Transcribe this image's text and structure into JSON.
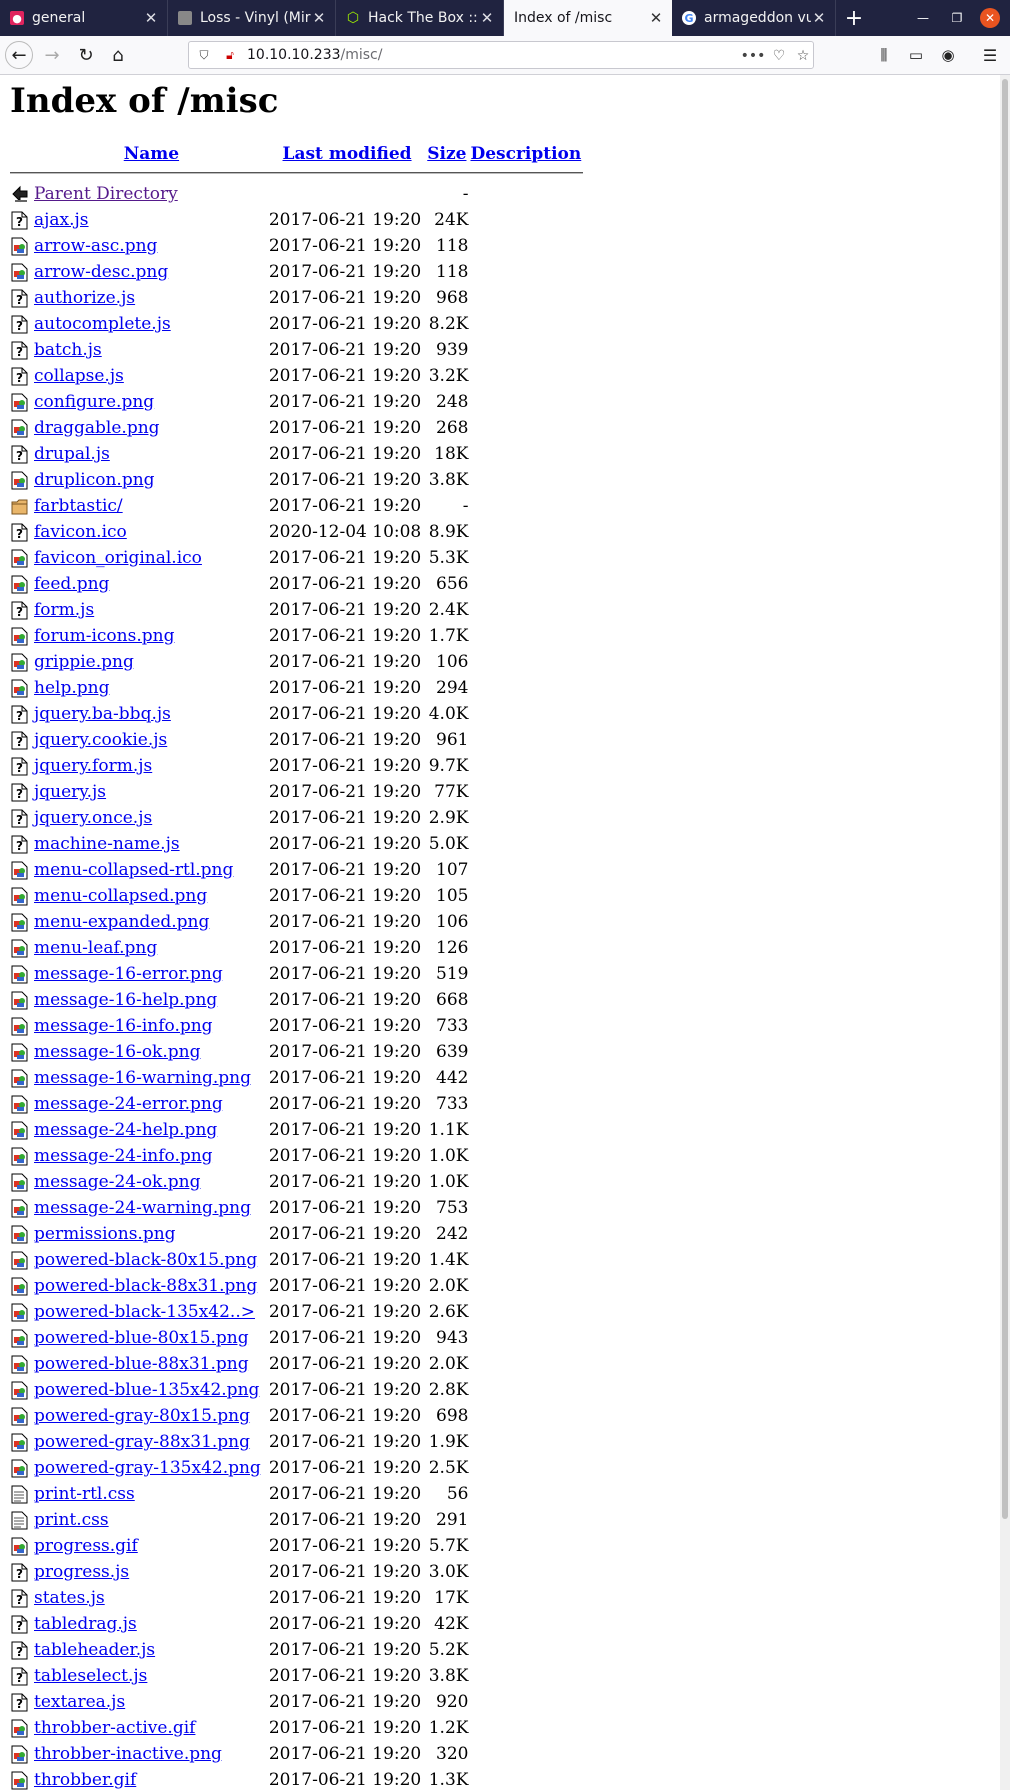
{
  "tabs": [
    {
      "title": "general",
      "favicon": "chat-app-icon",
      "color": "#e0245e"
    },
    {
      "title": "Loss - Vinyl (Mir",
      "favicon": "album-art-icon",
      "color": "#888888"
    },
    {
      "title": "Hack The Box :: I",
      "favicon": "htb-cube-icon",
      "color": "#9fef00"
    },
    {
      "title": "Index of /misc",
      "favicon": "",
      "color": ""
    },
    {
      "title": "armageddon vul",
      "favicon": "google-g-icon",
      "color": "#4285f4"
    }
  ],
  "address": {
    "host": "10.10.10.233",
    "path": "/misc/"
  },
  "page": {
    "title": "Index of /misc",
    "headers": {
      "name": "Name",
      "modified": "Last modified",
      "size": "Size",
      "description": "Description"
    }
  },
  "entries": [
    {
      "icon": "back",
      "name": "Parent Directory",
      "date": "",
      "size": "-"
    },
    {
      "icon": "unknown",
      "name": "ajax.js",
      "date": "2017-06-21 19:20",
      "size": "24K"
    },
    {
      "icon": "image",
      "name": "arrow-asc.png",
      "date": "2017-06-21 19:20",
      "size": "118"
    },
    {
      "icon": "image",
      "name": "arrow-desc.png",
      "date": "2017-06-21 19:20",
      "size": "118"
    },
    {
      "icon": "unknown",
      "name": "authorize.js",
      "date": "2017-06-21 19:20",
      "size": "968"
    },
    {
      "icon": "unknown",
      "name": "autocomplete.js",
      "date": "2017-06-21 19:20",
      "size": "8.2K"
    },
    {
      "icon": "unknown",
      "name": "batch.js",
      "date": "2017-06-21 19:20",
      "size": "939"
    },
    {
      "icon": "unknown",
      "name": "collapse.js",
      "date": "2017-06-21 19:20",
      "size": "3.2K"
    },
    {
      "icon": "image",
      "name": "configure.png",
      "date": "2017-06-21 19:20",
      "size": "248"
    },
    {
      "icon": "image",
      "name": "draggable.png",
      "date": "2017-06-21 19:20",
      "size": "268"
    },
    {
      "icon": "unknown",
      "name": "drupal.js",
      "date": "2017-06-21 19:20",
      "size": "18K"
    },
    {
      "icon": "image",
      "name": "druplicon.png",
      "date": "2017-06-21 19:20",
      "size": "3.8K"
    },
    {
      "icon": "folder",
      "name": "farbtastic/",
      "date": "2017-06-21 19:20",
      "size": "-"
    },
    {
      "icon": "unknown",
      "name": "favicon.ico",
      "date": "2020-12-04 10:08",
      "size": "8.9K"
    },
    {
      "icon": "image",
      "name": "favicon_original.ico",
      "date": "2017-06-21 19:20",
      "size": "5.3K"
    },
    {
      "icon": "image",
      "name": "feed.png",
      "date": "2017-06-21 19:20",
      "size": "656"
    },
    {
      "icon": "unknown",
      "name": "form.js",
      "date": "2017-06-21 19:20",
      "size": "2.4K"
    },
    {
      "icon": "image",
      "name": "forum-icons.png",
      "date": "2017-06-21 19:20",
      "size": "1.7K"
    },
    {
      "icon": "image",
      "name": "grippie.png",
      "date": "2017-06-21 19:20",
      "size": "106"
    },
    {
      "icon": "image",
      "name": "help.png",
      "date": "2017-06-21 19:20",
      "size": "294"
    },
    {
      "icon": "unknown",
      "name": "jquery.ba-bbq.js",
      "date": "2017-06-21 19:20",
      "size": "4.0K"
    },
    {
      "icon": "unknown",
      "name": "jquery.cookie.js",
      "date": "2017-06-21 19:20",
      "size": "961"
    },
    {
      "icon": "unknown",
      "name": "jquery.form.js",
      "date": "2017-06-21 19:20",
      "size": "9.7K"
    },
    {
      "icon": "unknown",
      "name": "jquery.js",
      "date": "2017-06-21 19:20",
      "size": "77K"
    },
    {
      "icon": "unknown",
      "name": "jquery.once.js",
      "date": "2017-06-21 19:20",
      "size": "2.9K"
    },
    {
      "icon": "unknown",
      "name": "machine-name.js",
      "date": "2017-06-21 19:20",
      "size": "5.0K"
    },
    {
      "icon": "image",
      "name": "menu-collapsed-rtl.png",
      "date": "2017-06-21 19:20",
      "size": "107"
    },
    {
      "icon": "image",
      "name": "menu-collapsed.png",
      "date": "2017-06-21 19:20",
      "size": "105"
    },
    {
      "icon": "image",
      "name": "menu-expanded.png",
      "date": "2017-06-21 19:20",
      "size": "106"
    },
    {
      "icon": "image",
      "name": "menu-leaf.png",
      "date": "2017-06-21 19:20",
      "size": "126"
    },
    {
      "icon": "image",
      "name": "message-16-error.png",
      "date": "2017-06-21 19:20",
      "size": "519"
    },
    {
      "icon": "image",
      "name": "message-16-help.png",
      "date": "2017-06-21 19:20",
      "size": "668"
    },
    {
      "icon": "image",
      "name": "message-16-info.png",
      "date": "2017-06-21 19:20",
      "size": "733"
    },
    {
      "icon": "image",
      "name": "message-16-ok.png",
      "date": "2017-06-21 19:20",
      "size": "639"
    },
    {
      "icon": "image",
      "name": "message-16-warning.png",
      "date": "2017-06-21 19:20",
      "size": "442"
    },
    {
      "icon": "image",
      "name": "message-24-error.png",
      "date": "2017-06-21 19:20",
      "size": "733"
    },
    {
      "icon": "image",
      "name": "message-24-help.png",
      "date": "2017-06-21 19:20",
      "size": "1.1K"
    },
    {
      "icon": "image",
      "name": "message-24-info.png",
      "date": "2017-06-21 19:20",
      "size": "1.0K"
    },
    {
      "icon": "image",
      "name": "message-24-ok.png",
      "date": "2017-06-21 19:20",
      "size": "1.0K"
    },
    {
      "icon": "image",
      "name": "message-24-warning.png",
      "date": "2017-06-21 19:20",
      "size": "753"
    },
    {
      "icon": "image",
      "name": "permissions.png",
      "date": "2017-06-21 19:20",
      "size": "242"
    },
    {
      "icon": "image",
      "name": "powered-black-80x15.png",
      "date": "2017-06-21 19:20",
      "size": "1.4K"
    },
    {
      "icon": "image",
      "name": "powered-black-88x31.png",
      "date": "2017-06-21 19:20",
      "size": "2.0K"
    },
    {
      "icon": "image",
      "name": "powered-black-135x42..>",
      "date": "2017-06-21 19:20",
      "size": "2.6K"
    },
    {
      "icon": "image",
      "name": "powered-blue-80x15.png",
      "date": "2017-06-21 19:20",
      "size": "943"
    },
    {
      "icon": "image",
      "name": "powered-blue-88x31.png",
      "date": "2017-06-21 19:20",
      "size": "2.0K"
    },
    {
      "icon": "image",
      "name": "powered-blue-135x42.png",
      "date": "2017-06-21 19:20",
      "size": "2.8K"
    },
    {
      "icon": "image",
      "name": "powered-gray-80x15.png",
      "date": "2017-06-21 19:20",
      "size": "698"
    },
    {
      "icon": "image",
      "name": "powered-gray-88x31.png",
      "date": "2017-06-21 19:20",
      "size": "1.9K"
    },
    {
      "icon": "image",
      "name": "powered-gray-135x42.png",
      "date": "2017-06-21 19:20",
      "size": "2.5K"
    },
    {
      "icon": "text",
      "name": "print-rtl.css",
      "date": "2017-06-21 19:20",
      "size": "56"
    },
    {
      "icon": "text",
      "name": "print.css",
      "date": "2017-06-21 19:20",
      "size": "291"
    },
    {
      "icon": "image",
      "name": "progress.gif",
      "date": "2017-06-21 19:20",
      "size": "5.7K"
    },
    {
      "icon": "unknown",
      "name": "progress.js",
      "date": "2017-06-21 19:20",
      "size": "3.0K"
    },
    {
      "icon": "unknown",
      "name": "states.js",
      "date": "2017-06-21 19:20",
      "size": "17K"
    },
    {
      "icon": "unknown",
      "name": "tabledrag.js",
      "date": "2017-06-21 19:20",
      "size": "42K"
    },
    {
      "icon": "unknown",
      "name": "tableheader.js",
      "date": "2017-06-21 19:20",
      "size": "5.2K"
    },
    {
      "icon": "unknown",
      "name": "tableselect.js",
      "date": "2017-06-21 19:20",
      "size": "3.8K"
    },
    {
      "icon": "unknown",
      "name": "textarea.js",
      "date": "2017-06-21 19:20",
      "size": "920"
    },
    {
      "icon": "image",
      "name": "throbber-active.gif",
      "date": "2017-06-21 19:20",
      "size": "1.2K"
    },
    {
      "icon": "image",
      "name": "throbber-inactive.png",
      "date": "2017-06-21 19:20",
      "size": "320"
    },
    {
      "icon": "image",
      "name": "throbber.gif",
      "date": "2017-06-21 19:20",
      "size": "1.3K"
    }
  ],
  "colors": {
    "link": "#0000ee",
    "visited": "#551a8b",
    "tabbar": "#202340",
    "close": "#e95420"
  }
}
